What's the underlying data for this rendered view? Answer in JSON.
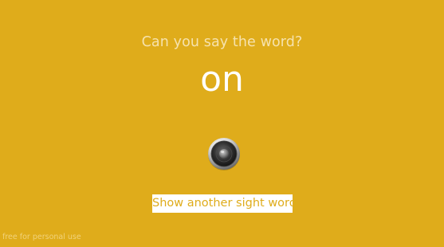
{
  "screen": {
    "background_color": "#dfac1b"
  },
  "quiz": {
    "prompt": "Can you say the word?",
    "word": "on"
  },
  "speaker": {
    "icon": "speaker-icon"
  },
  "actions": {
    "show_another_label": "Show another sight word"
  },
  "watermark": {
    "text": "free for personal use"
  }
}
